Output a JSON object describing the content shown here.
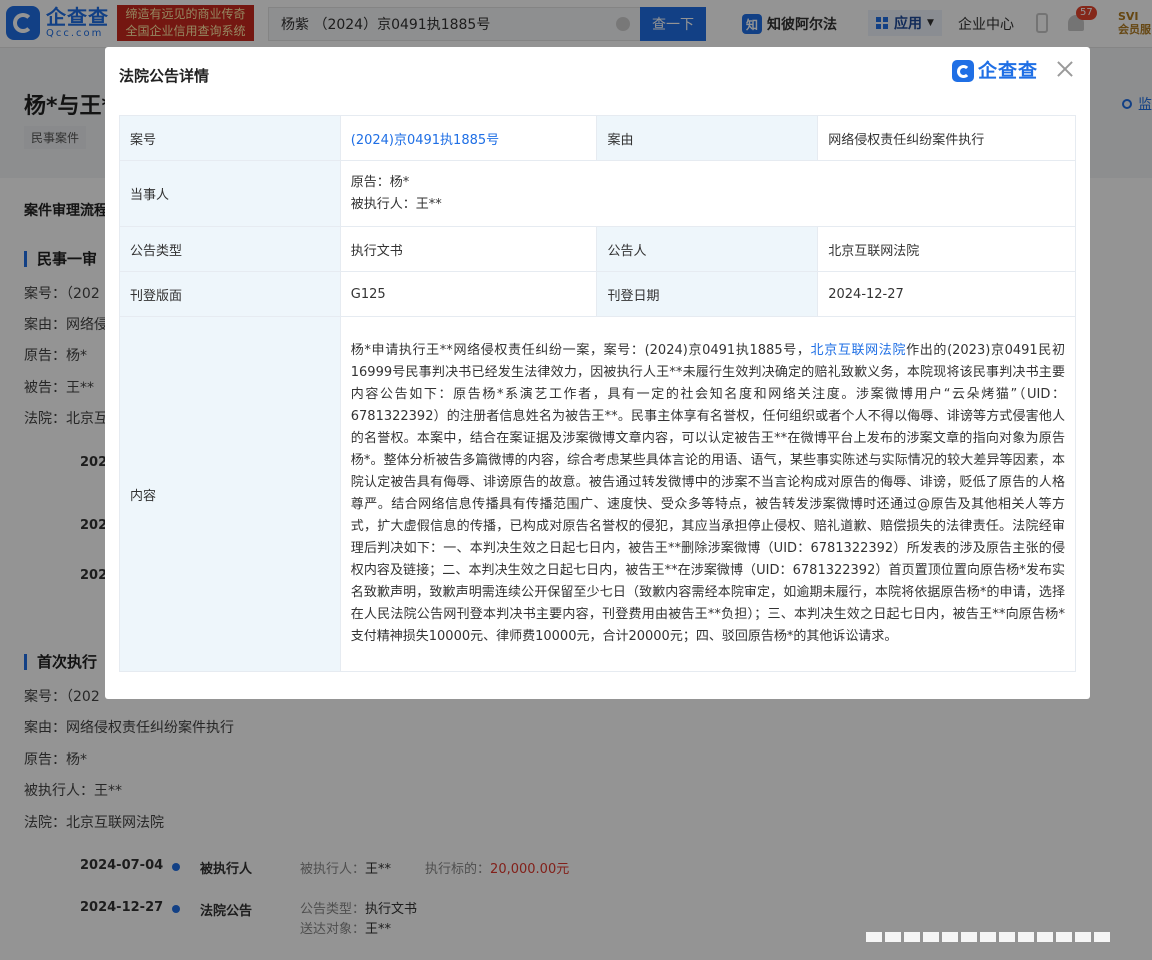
{
  "header": {
    "logo_cn": "企查查",
    "logo_en": "Qcc.com",
    "slogan_line1": "缔造有远见的商业传奇",
    "slogan_line2": "全国企业信用查询系统",
    "search_value": "杨紫 （2024）京0491执1885号",
    "search_button": "查一下",
    "knowledge_icon": "知",
    "knowledge_label": "知彼阿尔法",
    "apps_label": "应用",
    "enterprise_label": "企业中心",
    "notification_count": "57",
    "svip_line1": "SVI",
    "svip_line2": "会员服"
  },
  "background": {
    "title": "杨*与王*",
    "tag": "民事案件",
    "monitor_label": "监",
    "section_title": "案件审理流程",
    "first_trial": {
      "heading": "民事一审",
      "lines": [
        "案号：（202",
        "案由：网络侵",
        "原告：杨*",
        "被告：王**",
        "法院：北京互"
      ],
      "dates": [
        "202",
        "202",
        "202"
      ]
    },
    "execution": {
      "heading": "首次执行",
      "lines": [
        "案号：（202",
        "案由：网络侵权责任纠纷案件执行",
        "原告：杨*",
        "被执行人：王**",
        "法院：北京互联网法院"
      ],
      "timeline": [
        {
          "date": "2024-07-04",
          "type": "被执行人",
          "k1": "被执行人：",
          "v1": "王**",
          "k2": "执行标的：",
          "v2": "20,000.00元"
        },
        {
          "date": "2024-12-27",
          "type": "法院公告",
          "k1": "公告类型：",
          "v1": "执行文书",
          "k2": "送达对象：",
          "v2": "王**"
        }
      ]
    }
  },
  "modal": {
    "title": "法院公告详情",
    "logo_text": "企查查",
    "rows": {
      "case_no_label": "案号",
      "case_no_value": "(2024)京0491执1885号",
      "cause_label": "案由",
      "cause_value": "网络侵权责任纠纷案件执行",
      "party_label": "当事人",
      "plaintiff": "原告：杨*",
      "executee": "被执行人：王**",
      "type_label": "公告类型",
      "type_value": "执行文书",
      "announcer_label": "公告人",
      "announcer_value": "北京互联网法院",
      "page_label": "刊登版面",
      "page_value": "G125",
      "date_label": "刊登日期",
      "date_value": "2024-12-27",
      "content_label": "内容",
      "content_part1": "杨*申请执行王**网络侵权责任纠纷一案，案号：(2024)京0491执1885号，",
      "content_link": "北京互联网法院",
      "content_part2": "作出的(2023)京0491民初16999号民事判决书已经发生法律效力，因被执行人王**未履行生效判决确定的赔礼致歉义务，本院现将该民事判决书主要内容公告如下：原告杨*系演艺工作者，具有一定的社会知名度和网络关注度。涉案微博用户“云朵烤猫”（UID：6781322392）的注册者信息姓名为被告王**。民事主体享有名誉权，任何组织或者个人不得以侮辱、诽谤等方式侵害他人的名誉权。本案中，结合在案证据及涉案微博文章内容，可以认定被告王**在微博平台上发布的涉案文章的指向对象为原告杨*。整体分析被告多篇微博的内容，综合考虑某些具体言论的用语、语气，某些事实陈述与实际情况的较大差异等因素，本院认定被告具有侮辱、诽谤原告的故意。被告通过转发微博中的涉案不当言论构成对原告的侮辱、诽谤，贬低了原告的人格尊严。结合网络信息传播具有传播范围广、速度快、受众多等特点，被告转发涉案微博时还通过@原告及其他相关人等方式，扩大虚假信息的传播，已构成对原告名誉权的侵犯，其应当承担停止侵权、赔礼道歉、赔偿损失的法律责任。法院经审理后判决如下：一、本判决生效之日起七日内，被告王**删除涉案微博（UID：6781322392）所发表的涉及原告主张的侵权内容及链接；二、本判决生效之日起七日内，被告王**在涉案微博（UID：6781322392）首页置顶位置向原告杨*发布实名致歉声明，致歉声明需连续公开保留至少七日（致歉内容需经本院审定，如逾期未履行，本院将依据原告杨*的申请，选择在人民法院公告网刊登本判决书主要内容，刊登费用由被告王**负担）；三、本判决生效之日起七日内，被告王**向原告杨*支付精神损失10000元、律师费10000元，合计20000元；四、驳回原告杨*的其他诉讼请求。"
    }
  },
  "colors": {
    "brand": "#1f6fe5",
    "label_bg": "#eef6fb",
    "amount_red": "#e0382d"
  }
}
